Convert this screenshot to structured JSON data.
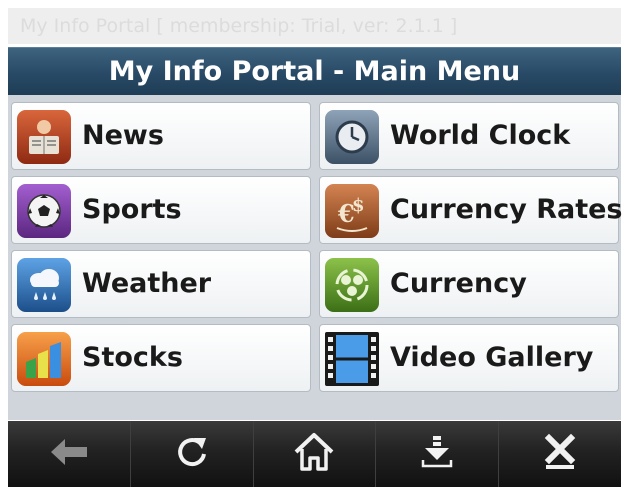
{
  "window": {
    "title": "My Info Portal [ membership: Trial, ver: 2.1.1 ]"
  },
  "header": {
    "title": "My Info Portal - Main Menu"
  },
  "menu": {
    "items": [
      {
        "label": "News",
        "icon": "newspaper-reader-icon",
        "color": "#a8391f"
      },
      {
        "label": "World Clock",
        "icon": "clock-icon",
        "color": "#54697f"
      },
      {
        "label": "Sports",
        "icon": "soccer-ball-icon",
        "color": "#7a3d9e"
      },
      {
        "label": "Currency Rates",
        "icon": "currency-exchange-icon",
        "color": "#a85a2e"
      },
      {
        "label": "Weather",
        "icon": "rain-cloud-icon",
        "color": "#2d6fb8"
      },
      {
        "label": "Currency",
        "icon": "currency-cycle-icon",
        "color": "#5a9a2a"
      },
      {
        "label": "Stocks",
        "icon": "bar-chart-icon",
        "color": "#e8641c"
      },
      {
        "label": "Video Gallery",
        "icon": "film-strip-icon",
        "color": "#3f86d6"
      }
    ]
  },
  "toolbar": {
    "buttons": [
      {
        "action": "back",
        "icon": "arrow-left-icon"
      },
      {
        "action": "refresh",
        "icon": "refresh-icon"
      },
      {
        "action": "home",
        "icon": "home-icon"
      },
      {
        "action": "download",
        "icon": "download-icon"
      },
      {
        "action": "close",
        "icon": "close-icon"
      }
    ]
  }
}
